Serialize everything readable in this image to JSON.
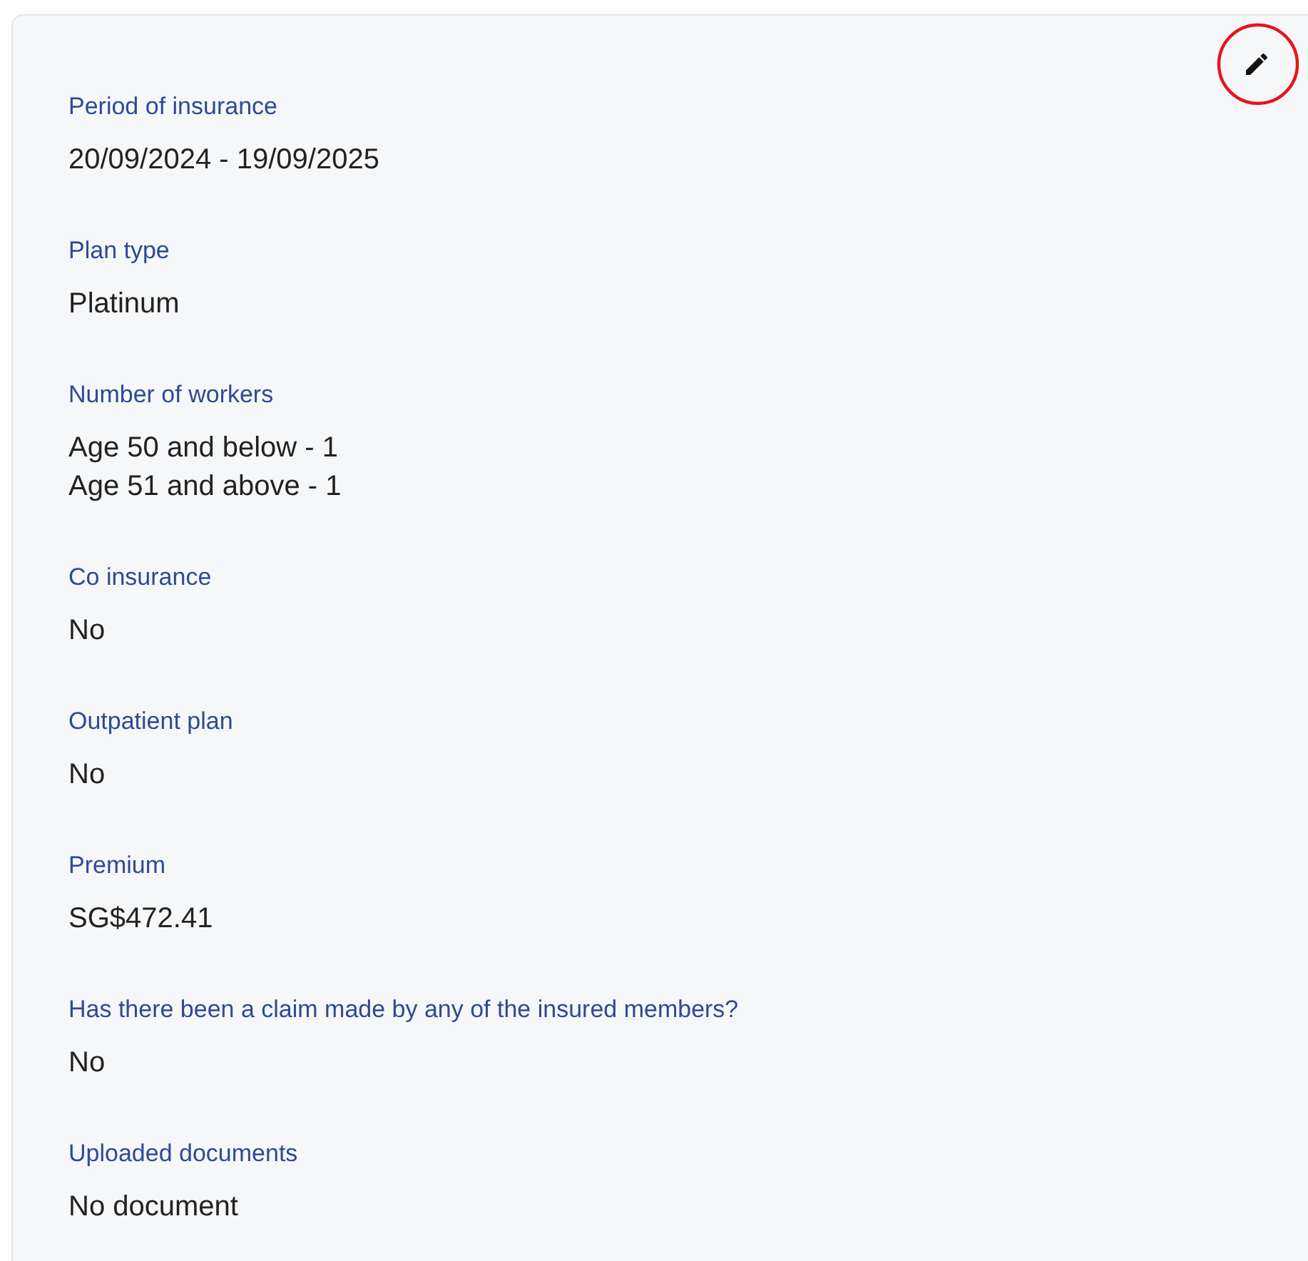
{
  "fields": [
    {
      "label": "Period of insurance",
      "values": [
        "20/09/2024 - 19/09/2025"
      ]
    },
    {
      "label": "Plan type",
      "values": [
        "Platinum"
      ]
    },
    {
      "label": "Number of workers",
      "values": [
        "Age 50 and below - 1",
        "Age 51 and above - 1"
      ]
    },
    {
      "label": "Co insurance",
      "values": [
        "No"
      ]
    },
    {
      "label": "Outpatient plan",
      "values": [
        "No"
      ]
    },
    {
      "label": "Premium",
      "values": [
        "SG$472.41"
      ]
    },
    {
      "label": "Has there been a claim made by any of the insured members?",
      "values": [
        "No"
      ]
    },
    {
      "label": "Uploaded documents",
      "values": [
        "No document"
      ]
    }
  ]
}
